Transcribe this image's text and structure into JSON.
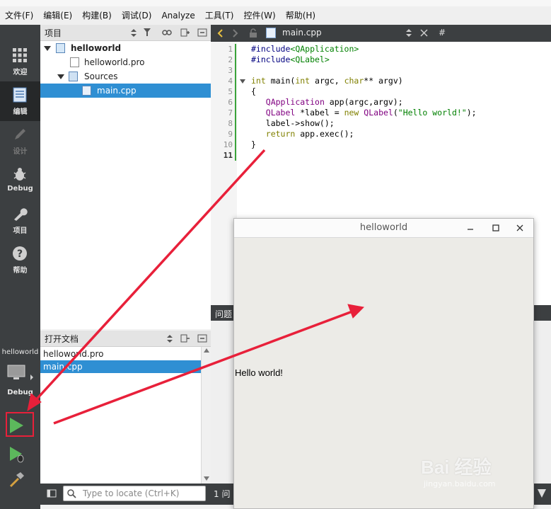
{
  "menubar": {
    "items": [
      "文件(F)",
      "编辑(E)",
      "构建(B)",
      "调试(D)",
      "Analyze",
      "工具(T)",
      "控件(W)",
      "帮助(H)"
    ]
  },
  "modes": [
    {
      "label": "欢迎",
      "icon": "grid-icon"
    },
    {
      "label": "编辑",
      "icon": "edit-document-icon"
    },
    {
      "label": "设计",
      "icon": "pencil-icon"
    },
    {
      "label": "Debug",
      "icon": "bug-icon"
    },
    {
      "label": "项目",
      "icon": "wrench-icon"
    },
    {
      "label": "帮助",
      "icon": "question-icon"
    }
  ],
  "target": {
    "project": "helloworld",
    "config": "Debug"
  },
  "project_pane": {
    "title": "项目",
    "tree": [
      {
        "label": "helloworld",
        "bold": true
      },
      {
        "label": "helloworld.pro"
      },
      {
        "label": "Sources"
      },
      {
        "label": "main.cpp",
        "selected": true
      }
    ]
  },
  "open_docs": {
    "title": "打开文档",
    "items": [
      {
        "label": "helloworld.pro"
      },
      {
        "label": "main.cpp",
        "selected": true
      }
    ]
  },
  "locator": {
    "placeholder": "Type to locate (Ctrl+K)",
    "tab1": "1 问"
  },
  "editor": {
    "file": "main.cpp",
    "hash": "#",
    "line_numbers": [
      "1",
      "2",
      "3",
      "4",
      "5",
      "6",
      "7",
      "8",
      "9",
      "10",
      "11"
    ],
    "lines": [
      "#include<QApplication>",
      "#include<QLabel>",
      "",
      "int main(int argc, char** argv)",
      "{",
      "   QApplication app(argc,argv);",
      "   QLabel *label = new QLabel(\"Hello world!\");",
      "   label->show();",
      "   return app.exec();",
      "}",
      ""
    ]
  },
  "issues_title": "问题",
  "hello_window": {
    "title": "helloworld",
    "label": "Hello world!"
  },
  "watermark": {
    "brand": "Bai 经验",
    "site": "jingyan.baidu.com"
  },
  "colors": {
    "accent": "#2f8fd3",
    "arrow": "#e8203a",
    "run_green": "#5cb85c"
  }
}
